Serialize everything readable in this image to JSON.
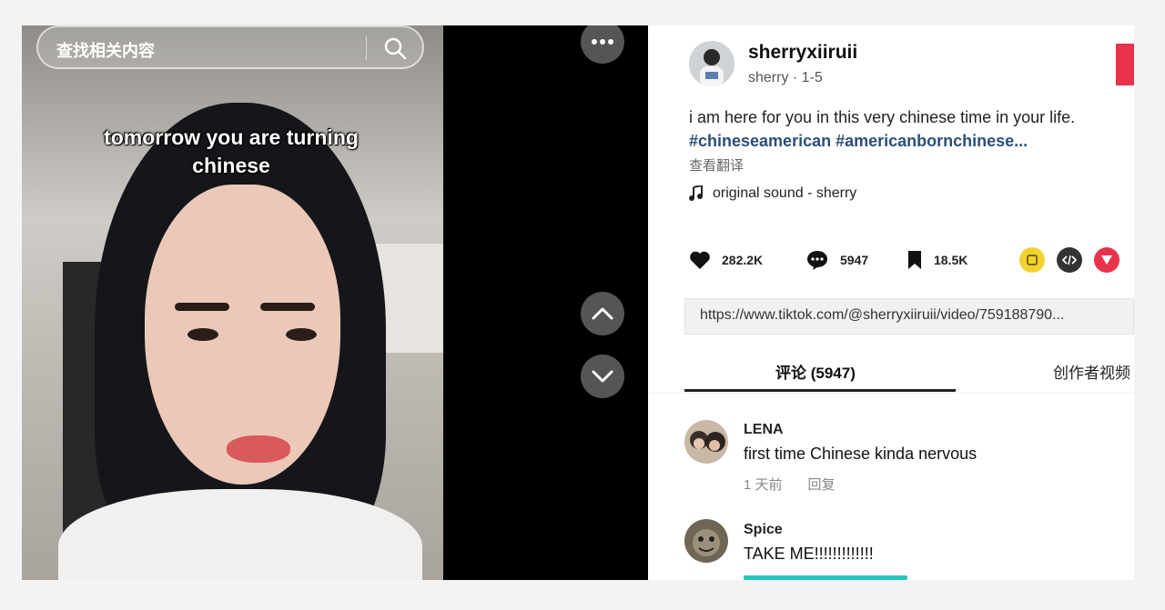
{
  "video": {
    "search_placeholder": "查找相关内容",
    "caption": "tomorrow you are turning chinese"
  },
  "author": {
    "username": "sherryxiiruii",
    "subline": "sherry · 1-5"
  },
  "post": {
    "description": "i am here for you in this very chinese time in your life.",
    "hashtags": "#chineseamerican #americanbornchinese...",
    "translate_label": "查看翻译",
    "sound": "original sound - sherry",
    "likes": "282.2K",
    "comments": "5947",
    "saves": "18.5K",
    "url": "https://www.tiktok.com/@sherryxiiruii/video/759188790..."
  },
  "tabs": {
    "comments_label": "评论 (5947)",
    "creator_videos_label": "创作者视频"
  },
  "comments": [
    {
      "name": "LENA",
      "text": "first time Chinese kinda nervous",
      "time": "1 天前",
      "reply": "回复"
    },
    {
      "name": "Spice",
      "text": "TAKE ME!!!!!!!!!!!!!"
    }
  ],
  "colors": {
    "accent_red": "#e8334b",
    "hashtag_blue": "#2b4f7a",
    "share_yellow": "#f2d22e",
    "share_dark": "#333333",
    "share_pink": "#e8334b"
  }
}
